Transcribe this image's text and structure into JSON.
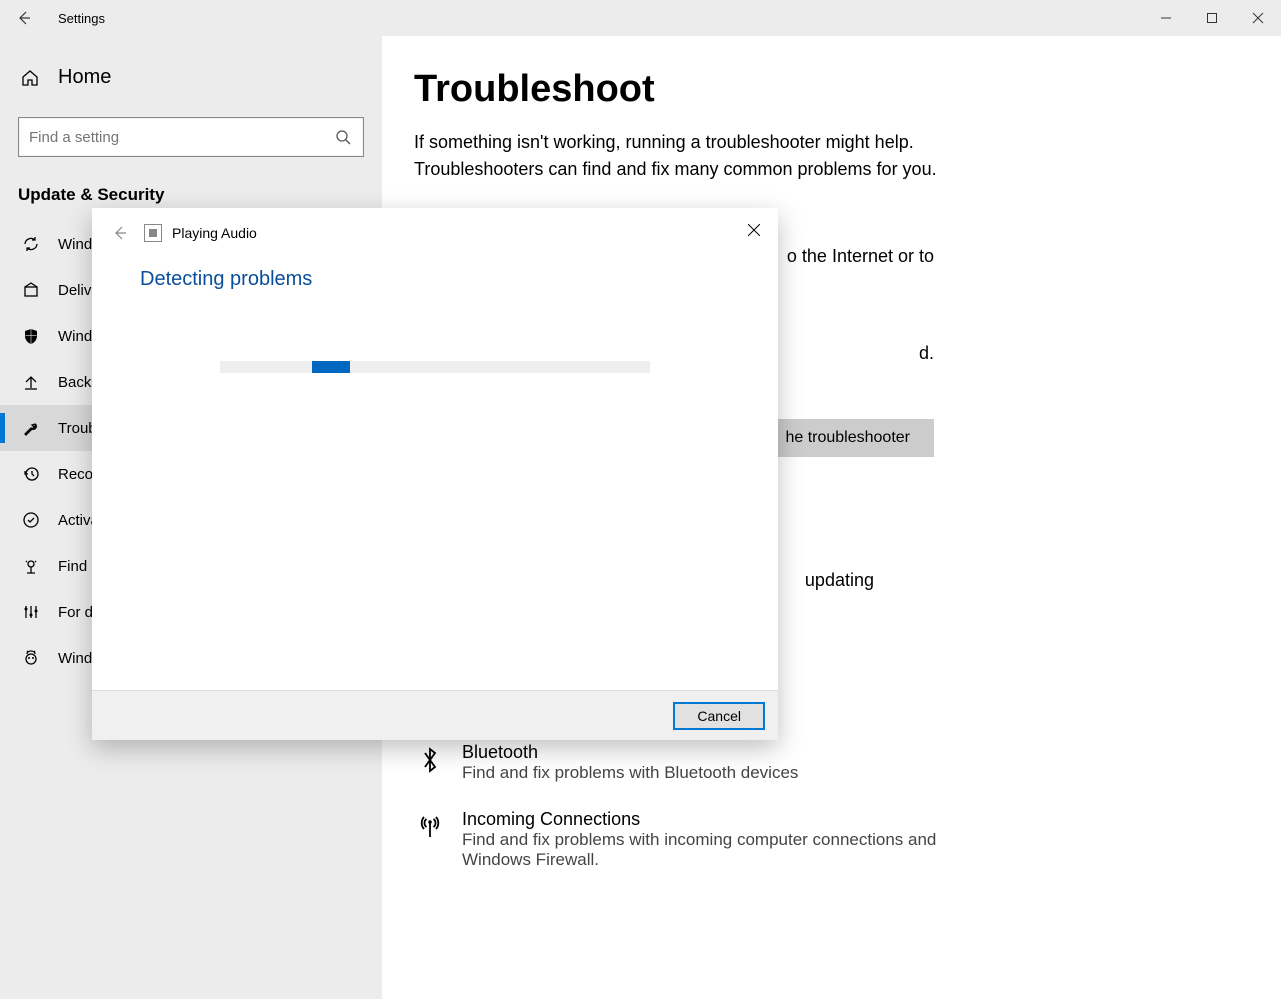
{
  "titlebar": {
    "title": "Settings"
  },
  "sidebar": {
    "home": "Home",
    "search_placeholder": "Find a setting",
    "category": "Update & Security",
    "items": [
      {
        "label": "Windows Update",
        "selected": false
      },
      {
        "label": "Delivery Optimisation",
        "selected": false
      },
      {
        "label": "Windows Security",
        "selected": false
      },
      {
        "label": "Backup",
        "selected": false
      },
      {
        "label": "Troubleshoot",
        "selected": true
      },
      {
        "label": "Recovery",
        "selected": false
      },
      {
        "label": "Activation",
        "selected": false
      },
      {
        "label": "Find My Device",
        "selected": false
      },
      {
        "label": "For developers",
        "selected": false
      },
      {
        "label": "Windows Insider Programme",
        "selected": false
      }
    ]
  },
  "main": {
    "heading": "Troubleshoot",
    "intro": "If something isn't working, running a troubleshooter might help. Troubleshooters can find and fix many common problems for you.",
    "partial_line1": "o the Internet or to",
    "partial_line2": "d.",
    "partial_button": "he troubleshooter",
    "partial_line3": "updating",
    "section2": "",
    "items": [
      {
        "title": "Bluetooth",
        "desc": "Find and fix problems with Bluetooth devices"
      },
      {
        "title": "Incoming Connections",
        "desc": "Find and fix problems with incoming computer connections and Windows Firewall."
      }
    ]
  },
  "dialog": {
    "title": "Playing Audio",
    "status": "Detecting problems",
    "cancel": "Cancel"
  }
}
